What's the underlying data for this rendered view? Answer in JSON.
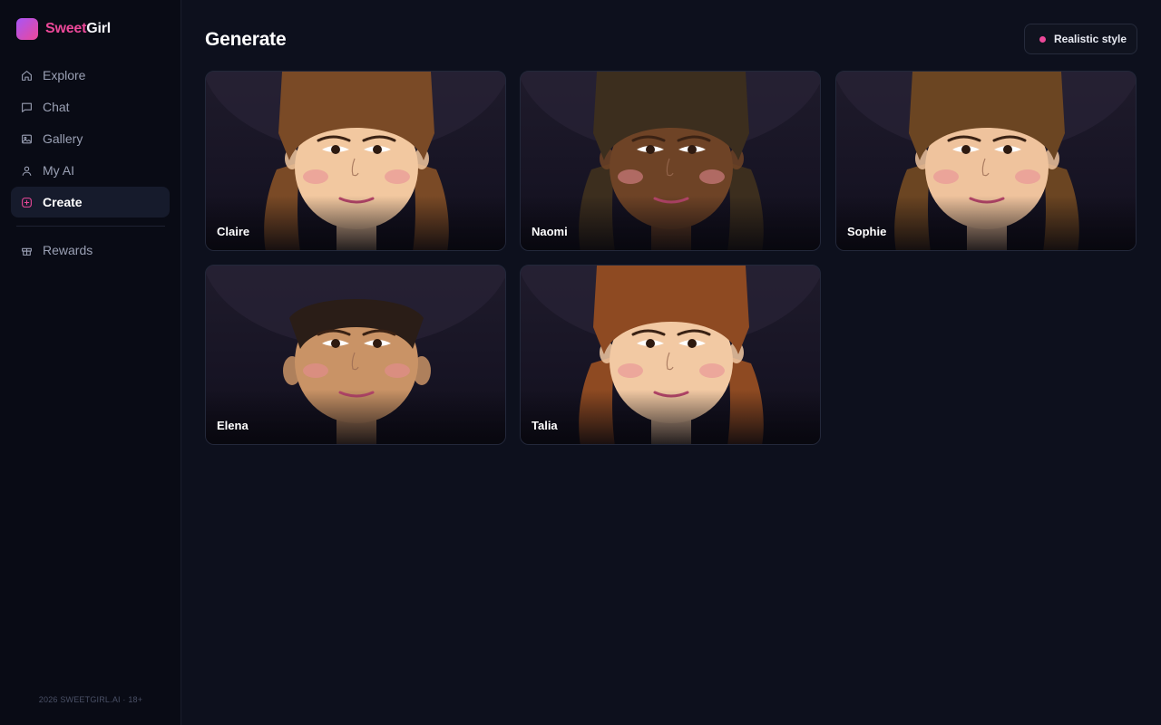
{
  "brand": {
    "name_part1": "Sweet",
    "name_part2": "Girl"
  },
  "sidebar": {
    "items": [
      {
        "label": "Explore",
        "icon": "home-icon"
      },
      {
        "label": "Chat",
        "icon": "chat-icon"
      },
      {
        "label": "Gallery",
        "icon": "image-icon"
      },
      {
        "label": "My AI",
        "icon": "user-icon"
      },
      {
        "label": "Create",
        "icon": "plus-square-icon",
        "active": true
      }
    ],
    "secondary": [
      {
        "label": "Rewards",
        "icon": "gift-icon"
      }
    ],
    "footer": "2026 SWEETGIRL.AI · 18+"
  },
  "main": {
    "title": "Generate",
    "style_button": "Realistic style",
    "cards": [
      {
        "name": "Claire",
        "skin": "#f2c8a0",
        "hair": "#7a4a26"
      },
      {
        "name": "Naomi",
        "skin": "#6e4326",
        "hair": "#3c2e1e"
      },
      {
        "name": "Sophie",
        "skin": "#efc39d",
        "hair": "#6b4522"
      },
      {
        "name": "Elena",
        "skin": "#c99366",
        "hair": "#2a1d17"
      },
      {
        "name": "Talia",
        "skin": "#f2c9a3",
        "hair": "#8e4a22"
      }
    ]
  },
  "colors": {
    "accent": "#ec4899",
    "background": "#0d101d",
    "sidebar": "#090b15"
  }
}
